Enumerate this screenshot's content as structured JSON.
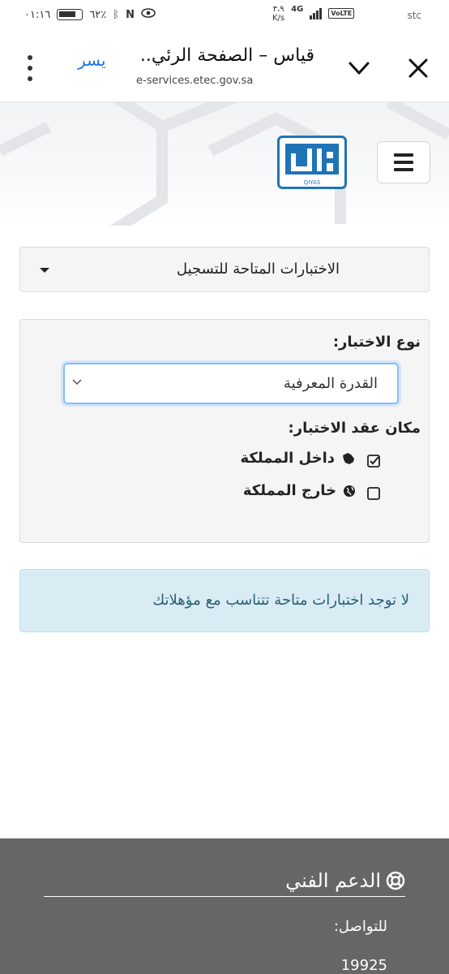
{
  "status_bar": {
    "time": "٠١:١٦",
    "battery": "٦٢٪",
    "speed_value": "٣،٩",
    "speed_unit": "K/s",
    "network": "4G",
    "volte": "VoLTE",
    "right_text": "stc"
  },
  "browser": {
    "title": "قياس – الصفحة الرئي..",
    "url": "e-services.etec.gov.sa",
    "link_text": "يسر"
  },
  "header": {
    "logo_text": "QIYAS"
  },
  "exams_dropdown": {
    "label": "الاختبارات المتاحة للتسجيل"
  },
  "filter": {
    "type_label": "نوع الاختبار:",
    "type_value": "القدرة المعرفية",
    "place_label": "مكان عقد الاختبار:",
    "options": [
      {
        "label": "داخل المملكة",
        "checked": true
      },
      {
        "label": "خارج المملكة",
        "checked": false
      }
    ]
  },
  "alert": {
    "message": "لا توجد اختبارات متاحة تتناسب مع مؤهلاتك"
  },
  "footer": {
    "heading": "الدعم الفني",
    "contact_label": "للتواصل:",
    "phone": "19925"
  },
  "colors": {
    "link": "#1a73e8",
    "select_focus": "#80bdff",
    "alert_bg": "#d9ecf4",
    "alert_text": "#2b5f74",
    "footer_bg": "#666666",
    "logo_blue": "#1f74b8"
  }
}
